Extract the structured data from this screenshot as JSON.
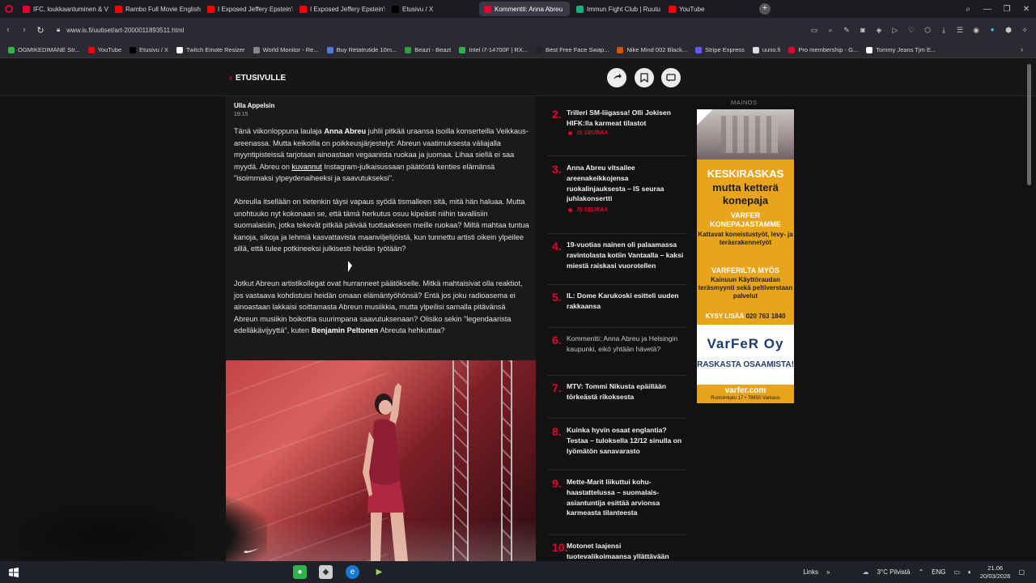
{
  "browser": {
    "tabs": [
      {
        "title": "IFC, loukkaantuminen & V",
        "icon_color": "#e4032e",
        "icon": "opera-icon",
        "active": false
      },
      {
        "title": "Rambo Full Movie English",
        "icon_color": "#ff0000",
        "icon": "youtube-icon",
        "active": false
      },
      {
        "title": "I Exposed Jeffery Epstein's",
        "icon_color": "#ff0000",
        "icon": "youtube-icon",
        "active": false
      },
      {
        "title": "I Exposed Jeffery Epstein's",
        "icon_color": "#ff0000",
        "icon": "youtube-icon",
        "active": false
      },
      {
        "title": "Etusivu / X",
        "icon_color": "#000000",
        "icon": "x-icon",
        "active": false
      },
      {
        "title": "Kommentti: Anna Abreu",
        "icon_color": "#e4032e",
        "icon": "is-icon",
        "active": true
      },
      {
        "title": "Immun Fight Club | Ruutu",
        "icon_color": "#18b07a",
        "icon": "ruutu-icon",
        "active": false
      },
      {
        "title": "YouTube",
        "icon_color": "#ff0000",
        "icon": "youtube-icon",
        "active": false
      }
    ],
    "new_tab": "+",
    "url": "www.is.fi/uutiset/art-2000011893511.html",
    "bookmarks": [
      {
        "label": "OGMIKEDIMANE Str...",
        "color": "#2fb34a"
      },
      {
        "label": "YouTube",
        "color": "#ff0000"
      },
      {
        "label": "Etusivu / X",
        "color": "#000000"
      },
      {
        "label": "Twitch Emote Resizer",
        "color": "#ffffff"
      },
      {
        "label": "World Monitor - Re...",
        "color": "#888888"
      },
      {
        "label": "Buy Retatrutide 10m...",
        "color": "#4a7bd8"
      },
      {
        "label": "Beazt - Beazt",
        "color": "#2ea043"
      },
      {
        "label": "Intel i7-14700F | RX...",
        "color": "#2fb34a"
      },
      {
        "label": "Best Free Face Swap...",
        "color": "#222222"
      },
      {
        "label": "Nike Mind 002 Black...",
        "color": "#d35400"
      },
      {
        "label": "Stripe Express",
        "color": "#635bff"
      },
      {
        "label": "uuno.fi",
        "color": "#dddddd"
      },
      {
        "label": "Pro membership - G...",
        "color": "#e4032e"
      },
      {
        "label": "Tommy Jeans Tjm E...",
        "color": "#ffffff"
      }
    ]
  },
  "site": {
    "back_label": "ETUSIVULLE"
  },
  "article": {
    "author": "Ulla Appelsin",
    "time": "19.15",
    "paragraphs": [
      {
        "segments": [
          {
            "t": "Tänä viikonloppuna laulaja "
          },
          {
            "t": "Anna Abreu",
            "b": true
          },
          {
            "t": " juhlii pitkää uraansa isoilla konserteilla Veikkaus-areenassa. Mutta keikoilla on poikkeusjärjestelyt: Abreun vaatimuksesta väliajalla myyntipisteissä tarjotaan ainoastaan vegaanista ruokaa ja juomaa. Lihaa siellä ei saa myydä. Abreu on "
          },
          {
            "t": "kuvannut",
            "u": true
          },
          {
            "t": " Instagram-julkaisussaan päätöstä kenties elämänsä \"isoimmaksi ylpeydenaiheeksi ja saavutukseksi\"."
          }
        ]
      },
      {
        "segments": [
          {
            "t": "Abreulla itsellään on tietenkin täysi vapaus syödä tismalleen sitä, mitä hän haluaa. Mutta unohtuuko nyt kokonaan se, että tämä herkutus osuu kipeästi niihin tavallisiin suomalaisiin, jotka tekevät pitkää päivää tuottaakseen meille ruokaa? Miltä mahtaa tuntua kanoja, sikoja ja lehmiä kasvattavista maanviljelijöistä, kun tunnettu artisti oikein ylpeilee sillä, että tulee potkineeksi julkisesti heidän työtään?"
          }
        ]
      },
      {
        "segments": [
          {
            "t": "Jotkut Abreun artistikollegat ovat hurranneet päätökselle. Mitkä mahtaisivat olla reaktiot, jos vastaava kohdistuisi heidän omaan elämäntyöhönsä? Entä jos joku radioasema ei ainoastaan lakkaisi soittamasta Abreun musiikkia, mutta ylpeilisi samalla pitävänsä Abreun musiikin boikottia suurimpana saavutuksenaan? Olisiko sekin \"legendaarista edelläkävijyyttä\", kuten "
          },
          {
            "t": "Benjamin Peltonen",
            "b": true
          },
          {
            "t": " Abreuta hehkuttaa?"
          }
        ]
      }
    ]
  },
  "most_read": [
    {
      "num": "2.",
      "title": "Trilleri SM-liigassa! Olli Jokisen HIFK:lla karmeat tilastot",
      "follow": "IS SEURAA"
    },
    {
      "num": "3.",
      "title": "Anna Abreu vitsailee areenakeikkojensa ruokalinjauksesta – IS seuraa juhlakonsertti",
      "follow": "IS SEURAA"
    },
    {
      "num": "4.",
      "title": "19-vuotias nainen oli palaamassa ravintolasta kotiin Vantaalla – kaksi miestä raiskasi vuorotellen",
      "follow": ""
    },
    {
      "num": "5.",
      "title": "IL: Dome Karukoski esitteli uuden rakkaansa",
      "follow": ""
    },
    {
      "num": "6.",
      "title": "Kommentti: Anna Abreu ja Helsingin kaupunki, eikö yhtään hävetä?",
      "follow": ""
    },
    {
      "num": "7.",
      "title": "MTV: Tommi Nikusta epäillään törkeästä rikoksesta",
      "follow": ""
    },
    {
      "num": "8.",
      "title": "Kuinka hyvin osaat englantia? Testaa – tuloksella 12/12 sinulla on lyömätön sanavarasto",
      "follow": ""
    },
    {
      "num": "9.",
      "title": "Mette-Marit liikuttui kohu-haastattelussa – suomalais-asiantuntija esittää arvionsa karmeasta tilanteesta",
      "follow": ""
    },
    {
      "num": "10.",
      "title": "Motonet laajensi tuotevalikoimaansa yllättävään suuntaan",
      "follow": ""
    }
  ],
  "ad": {
    "label": "MAINOS",
    "line1": "KESKIRASKAS",
    "line2": "mutta ketterä konepaja",
    "line3": "VARFER KONEPAJASTAMME",
    "line4": "Kattavat koneistustyöt, levy- ja teräsrakennetyöt",
    "line5": "VARFERILTA MYÖS",
    "line6": "Kainuun Käyttöraudan teräsmyynti sekä peltiverstaan palvelut",
    "cta": "KYSY LISÄÄ",
    "phone": "020 763 1840",
    "logo": "VarFeR Oy",
    "tagline": "RASKASTA OSAAMISTA!",
    "url": "varfer.com",
    "address": "Ruotsinkatu 17 • 78850 Varkaus"
  },
  "taskbar": {
    "links_label": "Links",
    "weather": "3°C  Pilvistä",
    "lang": "ENG",
    "time": "21.06",
    "date": "20/03/2026"
  }
}
